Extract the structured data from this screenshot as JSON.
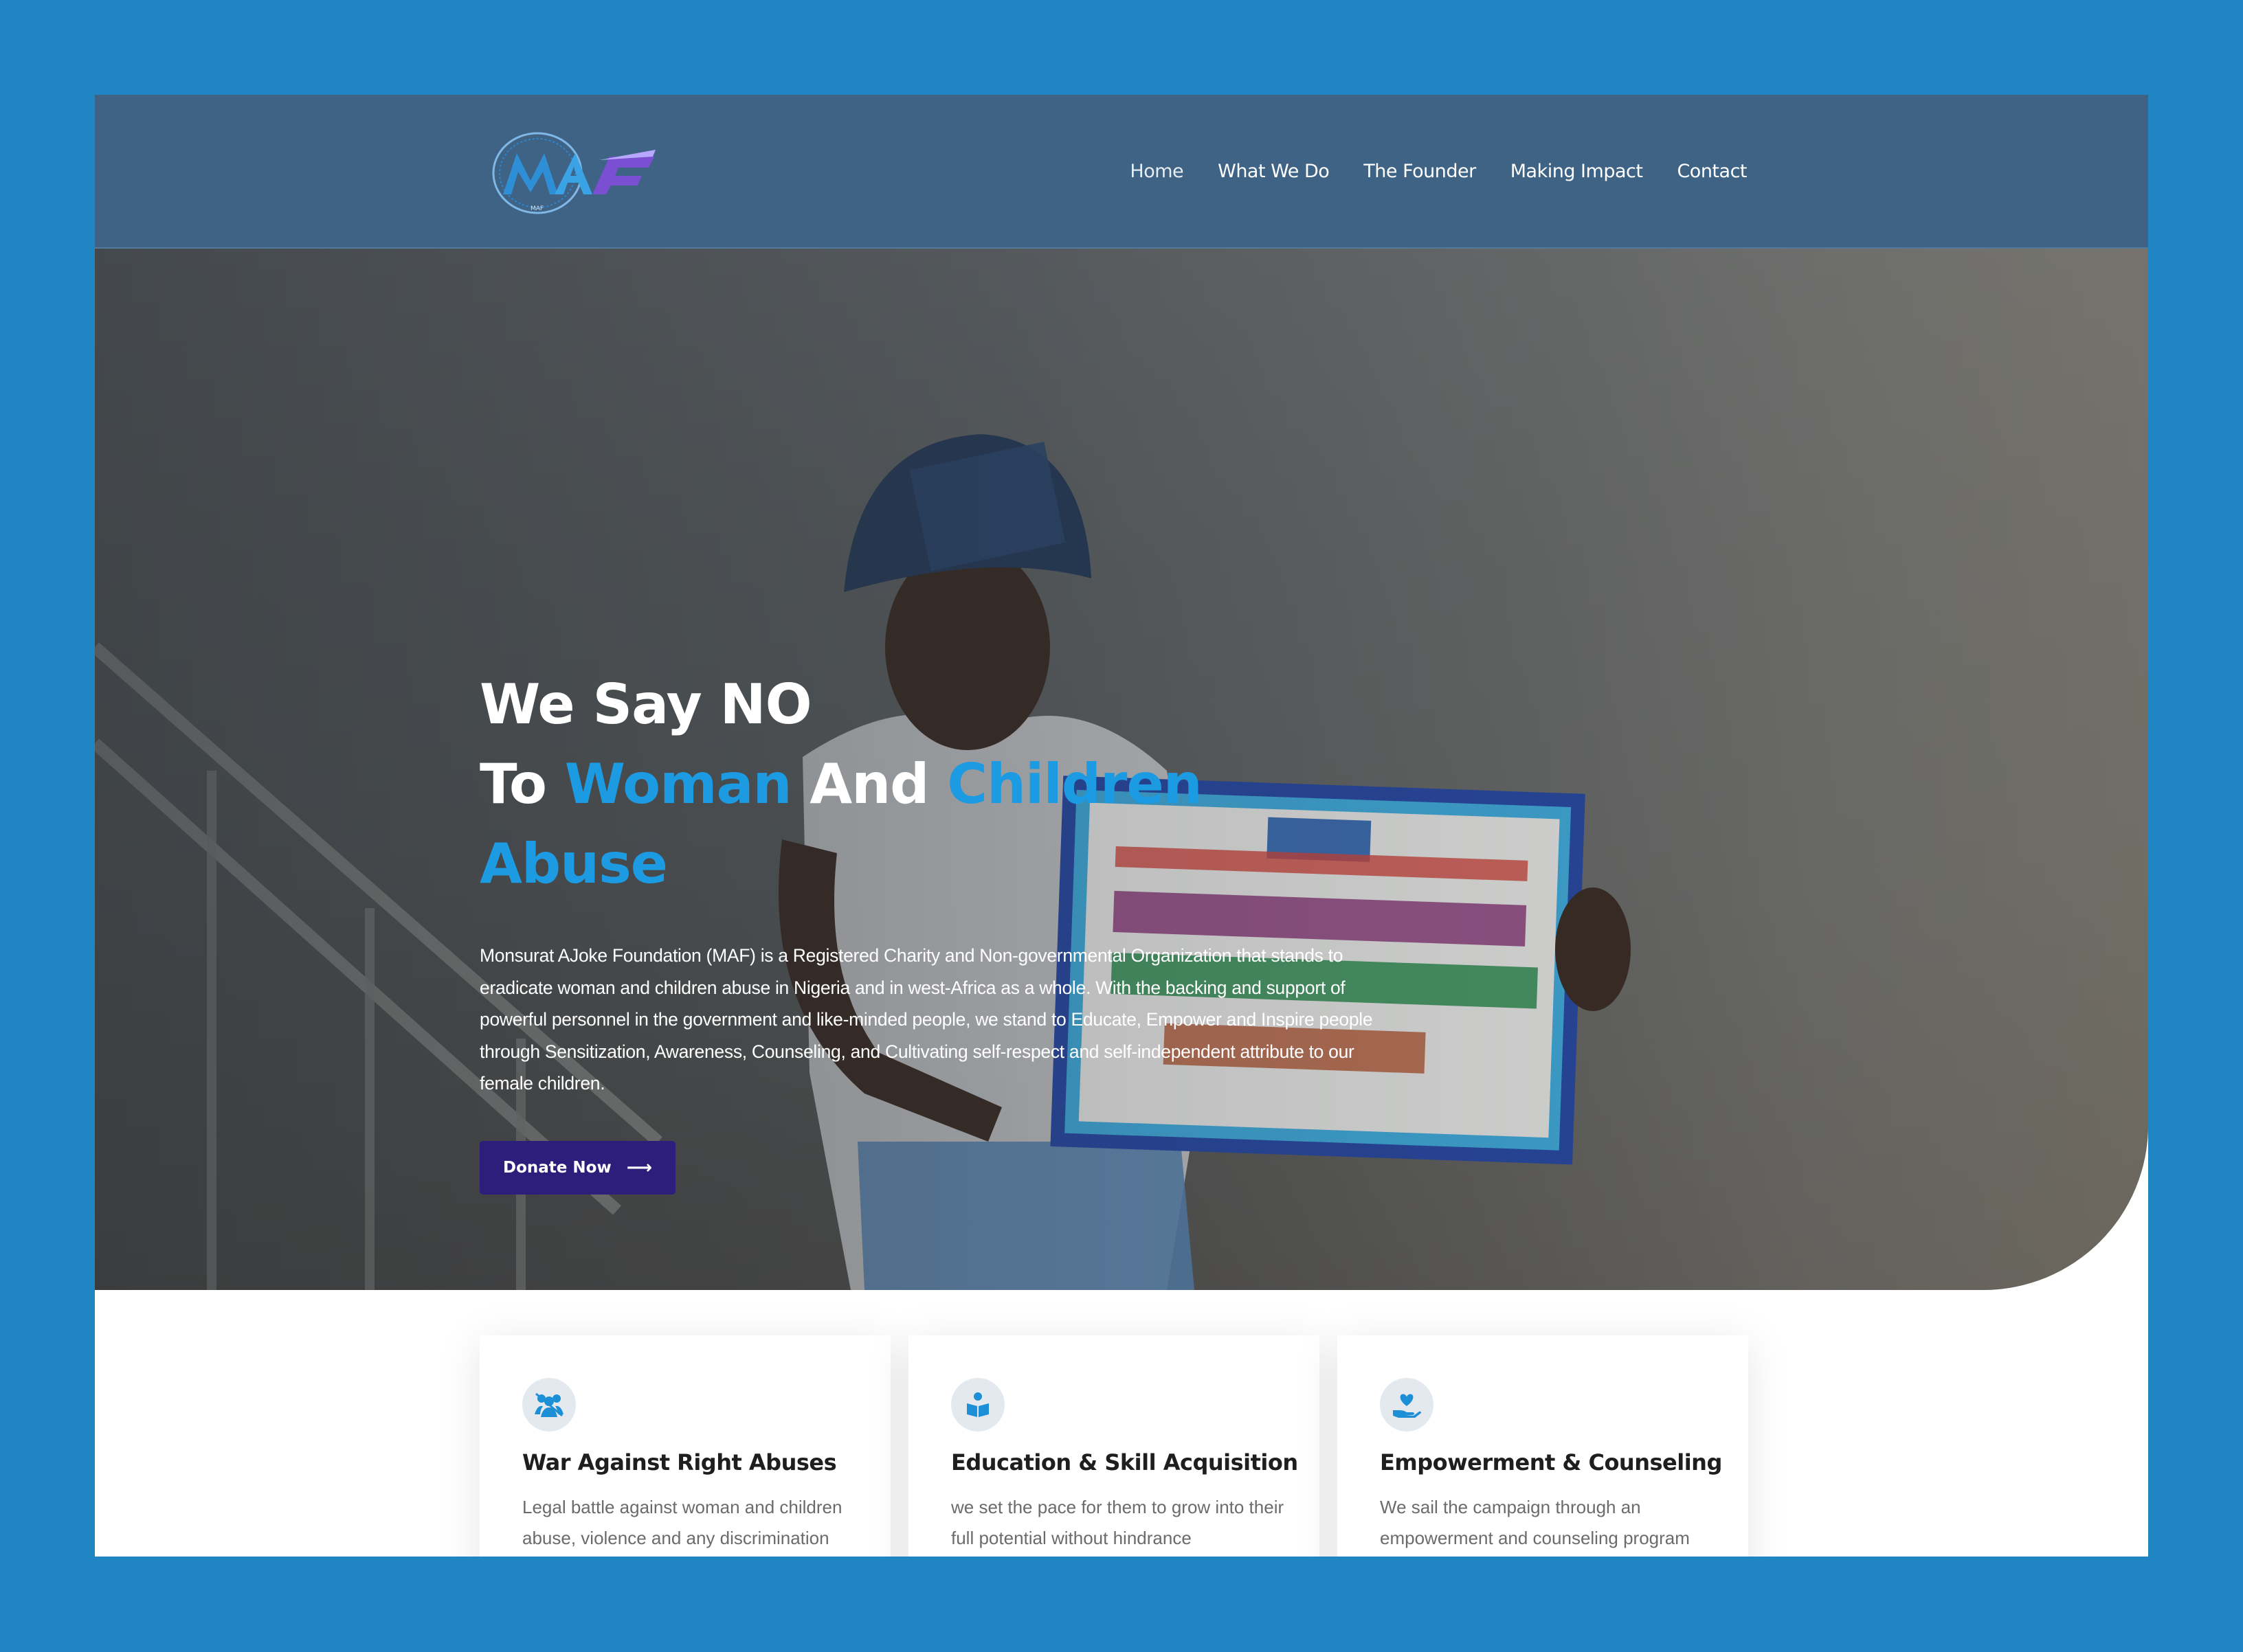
{
  "nav": {
    "items": [
      {
        "label": "Home"
      },
      {
        "label": "What We Do"
      },
      {
        "label": "The Founder"
      },
      {
        "label": "Making Impact"
      },
      {
        "label": "Contact"
      }
    ]
  },
  "logo": {
    "text": "MAF"
  },
  "hero": {
    "title_line1": "We Say NO",
    "title_to": "To ",
    "title_accent1": "Woman",
    "title_and": " And ",
    "title_accent2": "Children Abuse",
    "description": "Monsurat AJoke Foundation (MAF) is a Registered Charity and Non-governmental Organization that stands to eradicate woman and children abuse in Nigeria and in west-Africa as a whole. With the backing and support of powerful personnel in the government and like-minded people, we stand to Educate, Empower and Inspire people through Sensitization, Awareness, Counseling, and Cultivating self-respect and self-independent attribute to our female children.",
    "donate_label": "Donate Now",
    "donate_arrow": "⟶"
  },
  "cards": [
    {
      "icon": "group-icon",
      "title": "War Against Right Abuses",
      "description": "Legal battle against woman and children abuse, violence and any discrimination"
    },
    {
      "icon": "book-icon",
      "title": "Education & Skill Acquisition",
      "description": "we set the pace for them to grow into their full potential without hindrance"
    },
    {
      "icon": "heart-hand-icon",
      "title": "Empowerment & Counseling",
      "description": "We sail the campaign through an empowerment and counseling program"
    }
  ],
  "colors": {
    "page_background": "#1f86c3",
    "header": "#3f6385",
    "accent": "#1d9be2",
    "button": "#2c1e7a"
  }
}
